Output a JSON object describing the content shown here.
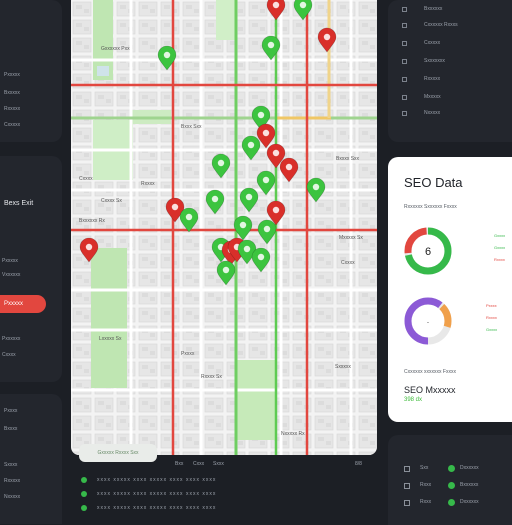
{
  "colors": {
    "accent_red": "#e2473f",
    "accent_green": "#36b94a",
    "accent_purple": "#8c5ad6",
    "panel": "#23262d",
    "background": "#1c1f25"
  },
  "left_top": {
    "items": [
      "Pxxxxx",
      "Bxxxxx",
      "Rxxxxx",
      "Cxxxxx"
    ]
  },
  "left_mid": {
    "title": "Bexs Exit",
    "items": [
      "Pxxxxx",
      "Vxxxxxx",
      "Sxxxxx",
      "Bxxxxx"
    ],
    "active_item": "Pxxxxx",
    "items_below": [
      "Pxxxxxx",
      "Cxxxx"
    ]
  },
  "left_bottom": {
    "items": [
      "Pxxxx",
      "Bxxxx",
      "Sxxxx",
      "Rxxxxx",
      "Nxxxxx"
    ]
  },
  "right_top": {
    "items": [
      "Bxxxxxx",
      "Cxxxxxx Rxxxs",
      "Cxxxxx",
      "Sxxxxxxx",
      "Rxxxxx",
      "Mxxxxx",
      "Nxxxxx"
    ]
  },
  "seo": {
    "title": "SEO Data",
    "subtitle": "Rxxxxxx Sxxxxxx Fxxxx",
    "donut1_value": "6",
    "donut2_value": ".",
    "legend1": [
      "Gxxxx",
      "Gxxxx",
      "Rxxxx"
    ],
    "legend2": [
      "Pxxxx",
      "Rxxxx",
      "Gxxxx"
    ],
    "note": "Cxxxxxx xxxxxxx Fxxxx",
    "footer_title": "SEO Mxxxxx",
    "footer_value": "398 dx"
  },
  "right_bottom": {
    "rows": [
      {
        "label": "Sxx",
        "value": "Dxxxxxx"
      },
      {
        "label": "Rxxx",
        "value": "Bxxxxxx"
      },
      {
        "label": "Rxxx",
        "value": "Dxxxxxx"
      }
    ]
  },
  "map_footer": {
    "pill": "Gxxxxx Rxxxx Sxx",
    "labels": [
      "Bxx",
      "Cxxx",
      "Sxxx"
    ],
    "page": "8/8",
    "rows": [
      "xxxx xxxxx xxxx xxxxx xxxx xxxx xxxx",
      "xxxx xxxxx xxxx xxxxx xxxx xxxx xxxx",
      "xxxx xxxxx xxxx xxxxx xxxx xxxx xxxx"
    ]
  },
  "map_labels": [
    "Gxxxxxx Pxx",
    "Bxxx Sxx",
    "Cxxxx",
    "Rxxxx",
    "Bxxxx Sxx",
    "Cxxxx Sx",
    "Bxxxxxx Rx",
    "Mxxxxx Sx",
    "Cxxxx",
    "Lxxxxx Sx",
    "Pxxxx",
    "Rxxxx Sx",
    "Sxxxxx",
    "Nxxxxx Rx"
  ]
}
